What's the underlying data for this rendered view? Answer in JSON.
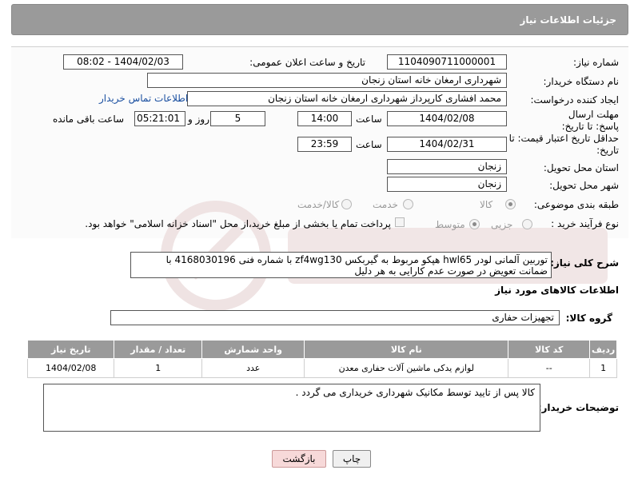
{
  "header": {
    "title": "جزئیات اطلاعات نیاز"
  },
  "form": {
    "need_number_label": "شماره نیاز:",
    "need_number": "1104090711000001",
    "announce_label": "تاریخ و ساعت اعلان عمومی:",
    "announce_value": "1404/02/03 - 08:02",
    "buyer_org_label": "نام دستگاه خریدار:",
    "buyer_org": "شهرداری ارمغان خانه استان زنجان",
    "creator_label": "ایجاد کننده درخواست:",
    "creator": "محمد افشاری کارپرداز شهرداری ارمغان خانه استان زنجان",
    "contact_link": "اطلاعات تماس خریدار",
    "deadline_label": "مهلت ارسال پاسخ: تا تاریخ:",
    "deadline_date": "1404/02/08",
    "time_label": "ساعت",
    "deadline_time": "14:00",
    "days": "5",
    "days_label": "روز و",
    "remaining": "05:21:01",
    "remaining_label": "ساعت باقی مانده",
    "validity_label": "حداقل تاریخ اعتبار قیمت: تا تاریخ:",
    "validity_date": "1404/02/31",
    "validity_time": "23:59",
    "province_label": "استان محل تحویل:",
    "province": "زنجان",
    "city_label": "شهر محل تحویل:",
    "city": "زنجان",
    "category_label": "طبقه بندی موضوعی:",
    "category_options": [
      "کالا",
      "خدمت",
      "کالا/خدمت"
    ],
    "process_label": "نوع فرآیند خرید :",
    "process_options": [
      "جزیی",
      "متوسط"
    ],
    "payment_note": "پرداخت تمام یا بخشی از مبلغ خرید،از محل \"اسناد خزانه اسلامی\" خواهد بود."
  },
  "description": {
    "label": "شرح کلی نیاز:",
    "text": "توربین آلمانی لودر hwl65  هپکو مربوط به گیربکس zf4wg130   با شماره فنی 4168030196 با ضمانت تعویض در صورت عدم کارایی به هر دلیل"
  },
  "goods": {
    "section_title": "اطلاعات کالاهای مورد نیاز",
    "group_label": "گروه کالا:",
    "group_value": "تجهیزات حفاری",
    "columns": [
      "ردیف",
      "کد کالا",
      "نام کالا",
      "واحد شمارش",
      "تعداد / مقدار",
      "تاریخ نیاز"
    ],
    "rows": [
      [
        "1",
        "--",
        "لوازم یدکی ماشین آلات حفاری معدن",
        "عدد",
        "1",
        "1404/02/08"
      ]
    ]
  },
  "buyer_notes": {
    "label": "توضیحات خریدار:",
    "text": "کالا پس از تایید توسط مکانیک شهرداری خریداری می گردد ."
  },
  "buttons": {
    "print": "چاپ",
    "back": "بازگشت"
  },
  "colors": {
    "header_bg": "#9a9a9a",
    "link": "#1a4fa0",
    "back_button_bg": "#f7d9d9"
  }
}
